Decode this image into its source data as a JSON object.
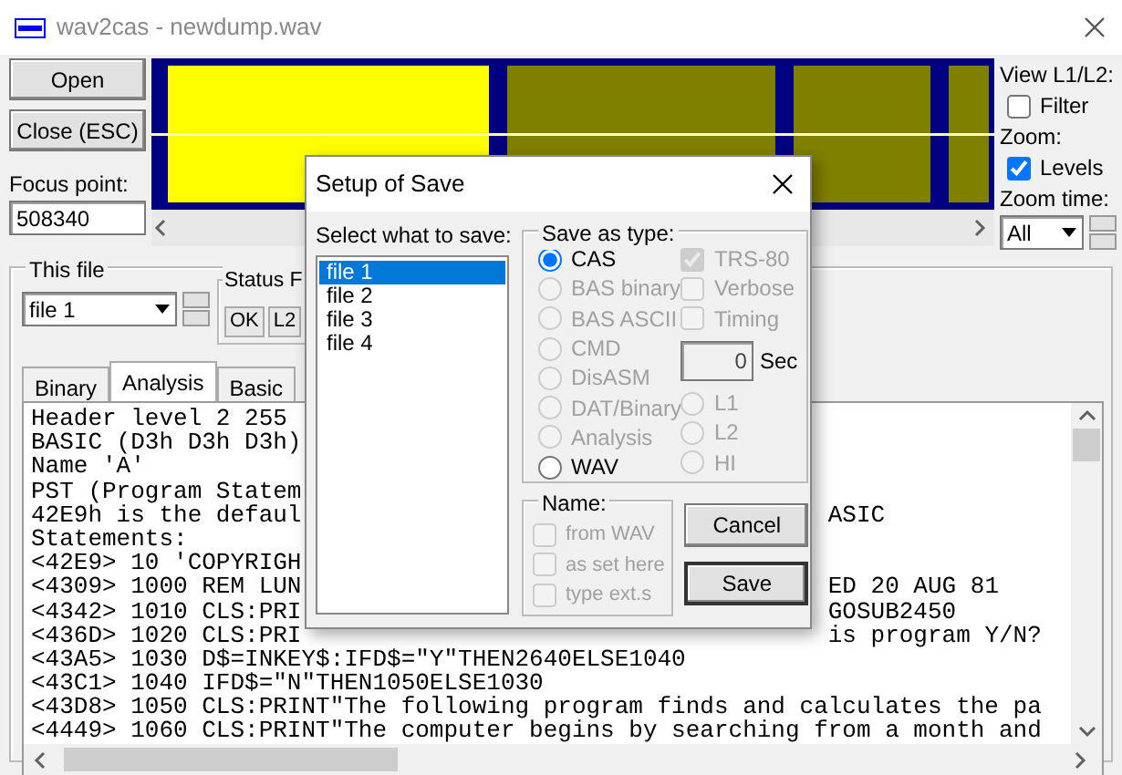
{
  "window": {
    "title": "wav2cas - newdump.wav"
  },
  "buttons": [
    {
      "label": "Open"
    },
    {
      "label": "Close (ESC)"
    }
  ],
  "focus_point": {
    "label": "Focus point:",
    "value": "508340"
  },
  "view": {
    "label": "View L1/L2:",
    "zoom_label": "Zoom:",
    "zoom_time_label": "Zoom time:",
    "zoom_time": "All",
    "checks": [
      {
        "label": "Filter",
        "checked": false
      },
      {
        "label": "Levels",
        "checked": true
      }
    ]
  },
  "this_file": {
    "title": "This file",
    "file": "file 1",
    "status_title": "Status F",
    "status_cells": [
      "OK",
      "L2"
    ],
    "tabs": [
      {
        "label": "Binary",
        "selected": false
      },
      {
        "label": "Analysis",
        "selected": true
      },
      {
        "label": "Basic",
        "selected": false
      }
    ],
    "lines": [
      {
        "text": "Header level 2 255"
      },
      {
        "text": "BASIC (D3h D3h D3h)"
      },
      {
        "text": "Name 'A'"
      },
      {
        "text": "PST (Program Statem"
      },
      {
        "text": "42E9h is the defaul",
        "right": "ASIC"
      },
      {
        "text": "Statements:"
      },
      {
        "text": "<42E9> 10 'COPYRIGH"
      },
      {
        "text": "<4309> 1000 REM LUN",
        "right": "ED 20 AUG 81"
      },
      {
        "text": "<4342> 1010 CLS:PRI",
        "right": "GOSUB2450"
      },
      {
        "text": "<436D> 1020 CLS:PRI",
        "right": "is program Y/N?"
      },
      {
        "text": "<43A5> 1030 D$=INKEY$:IFD$=\"Y\"THEN2640ELSE1040"
      },
      {
        "text": "<43C1> 1040 IFD$=\"N\"THEN1050ELSE1030"
      },
      {
        "text": "<43D8> 1050 CLS:PRINT\"The following program finds and calculates the pa"
      },
      {
        "text": "<4449> 1060 CLS:PRINT\"The computer begins by searching from a month and"
      }
    ]
  },
  "dialog": {
    "title": "Setup of Save",
    "list_label": "Select what to save:",
    "files": [
      {
        "label": "file 1",
        "selected": true
      },
      {
        "label": "file 2",
        "selected": false
      },
      {
        "label": "file 3",
        "selected": false
      },
      {
        "label": "file 4",
        "selected": false
      }
    ],
    "type_title": "Save as type:",
    "types": [
      {
        "label": "CAS",
        "selected": true,
        "disabled": false
      },
      {
        "label": "BAS binary",
        "selected": false,
        "disabled": true
      },
      {
        "label": "BAS ASCII",
        "selected": false,
        "disabled": true
      },
      {
        "label": "CMD",
        "selected": false,
        "disabled": true
      },
      {
        "label": "DisASM",
        "selected": false,
        "disabled": true
      },
      {
        "label": "DAT/Binary",
        "selected": false,
        "disabled": true
      },
      {
        "label": "Analysis",
        "selected": false,
        "disabled": true
      },
      {
        "label": "WAV",
        "selected": false,
        "disabled": false
      }
    ],
    "options": [
      {
        "label": "TRS-80",
        "checked": true,
        "disabled": true
      },
      {
        "label": "Verbose",
        "checked": false,
        "disabled": true
      },
      {
        "label": "Timing",
        "checked": false,
        "disabled": true
      }
    ],
    "seconds": {
      "value": "0",
      "unit": "Sec"
    },
    "levels": [
      {
        "label": "L1",
        "selected": false,
        "disabled": true
      },
      {
        "label": "L2",
        "selected": false,
        "disabled": true
      },
      {
        "label": "HI",
        "selected": false,
        "disabled": true
      }
    ],
    "name_title": "Name:",
    "name_options": [
      {
        "label": "from WAV",
        "checked": false,
        "disabled": true
      },
      {
        "label": "as set here",
        "checked": false,
        "disabled": true
      },
      {
        "label": "type ext.s",
        "checked": false,
        "disabled": true
      }
    ],
    "buttons": [
      {
        "label": "Cancel",
        "default": false
      },
      {
        "label": "Save",
        "default": true
      }
    ]
  }
}
